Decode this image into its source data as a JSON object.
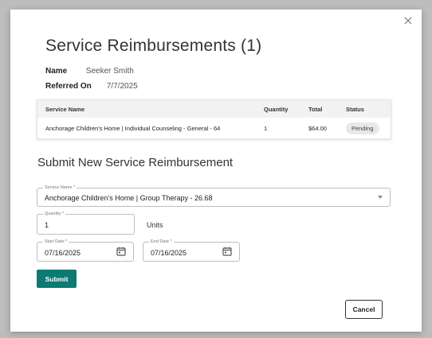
{
  "dialog": {
    "title": "Service Reimbursements (1)",
    "close_glyph": "×"
  },
  "client": {
    "name_label": "Name",
    "name_value": "Seeker Smith",
    "referred_label": "Referred On",
    "referred_value": "7/7/2025"
  },
  "table": {
    "headers": [
      "Service Name",
      "Quantity",
      "Total",
      "Status"
    ],
    "rows": [
      {
        "service_name": "Anchorage Children's Home | Individual Counseling - General - 64",
        "quantity": "1",
        "total": "$64.00",
        "status": "Pending"
      }
    ]
  },
  "form": {
    "section_title": "Submit New Service Reimbursement",
    "service_label": "Service Name *",
    "service_value": "Anchorage Children's Home | Group Therapy - 26.68",
    "quantity_label": "Quantity *",
    "quantity_value": "1",
    "units_label": "Units",
    "start_label": "Start Date *",
    "start_value": "07/16/2025",
    "end_label": "End Date *",
    "end_value": "07/16/2025",
    "submit_label": "Submit",
    "cancel_label": "Cancel"
  },
  "colors": {
    "accent": "#0b7a73",
    "backdrop": "#bdbdbd"
  },
  "icons": {
    "close": "close-icon",
    "dropdown": "chevron-down-icon",
    "calendar": "calendar-icon"
  }
}
